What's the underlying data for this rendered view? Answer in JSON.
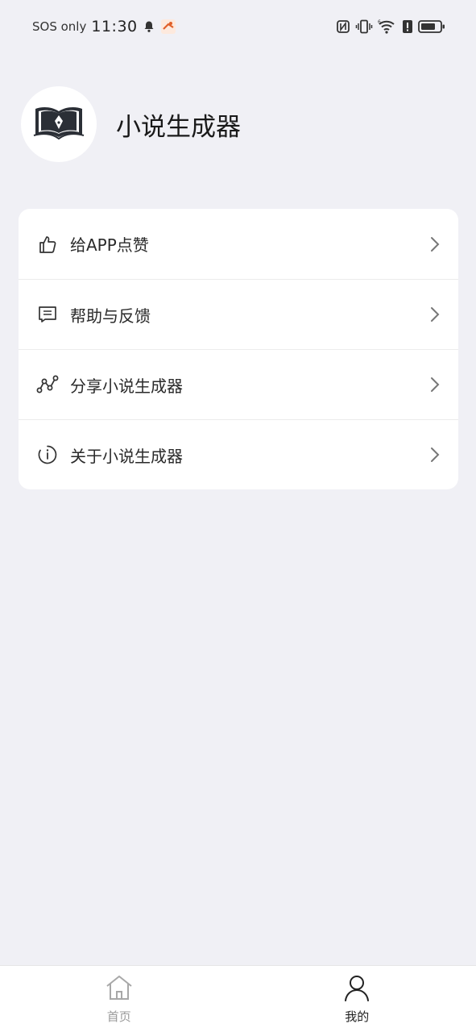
{
  "status_bar": {
    "carrier": "SOS only",
    "time": "11:30",
    "icons": [
      "bell-icon",
      "app-notification-icon",
      "nfc-icon",
      "vibrate-icon",
      "wifi-icon",
      "alert-icon",
      "battery-icon"
    ]
  },
  "profile": {
    "app_name": "小说生成器",
    "avatar_icon": "open-book-icon"
  },
  "menu": {
    "items": [
      {
        "label": "给APP点赞",
        "icon": "thumbs-up-icon"
      },
      {
        "label": "帮助与反馈",
        "icon": "message-icon"
      },
      {
        "label": "分享小说生成器",
        "icon": "share-icon"
      },
      {
        "label": "关于小说生成器",
        "icon": "info-icon"
      }
    ]
  },
  "tab_bar": {
    "tabs": [
      {
        "label": "首页",
        "icon": "home-icon",
        "active": false
      },
      {
        "label": "我的",
        "icon": "person-icon",
        "active": true
      }
    ],
    "active_color": "#222222",
    "inactive_color": "#9a9a9a"
  }
}
